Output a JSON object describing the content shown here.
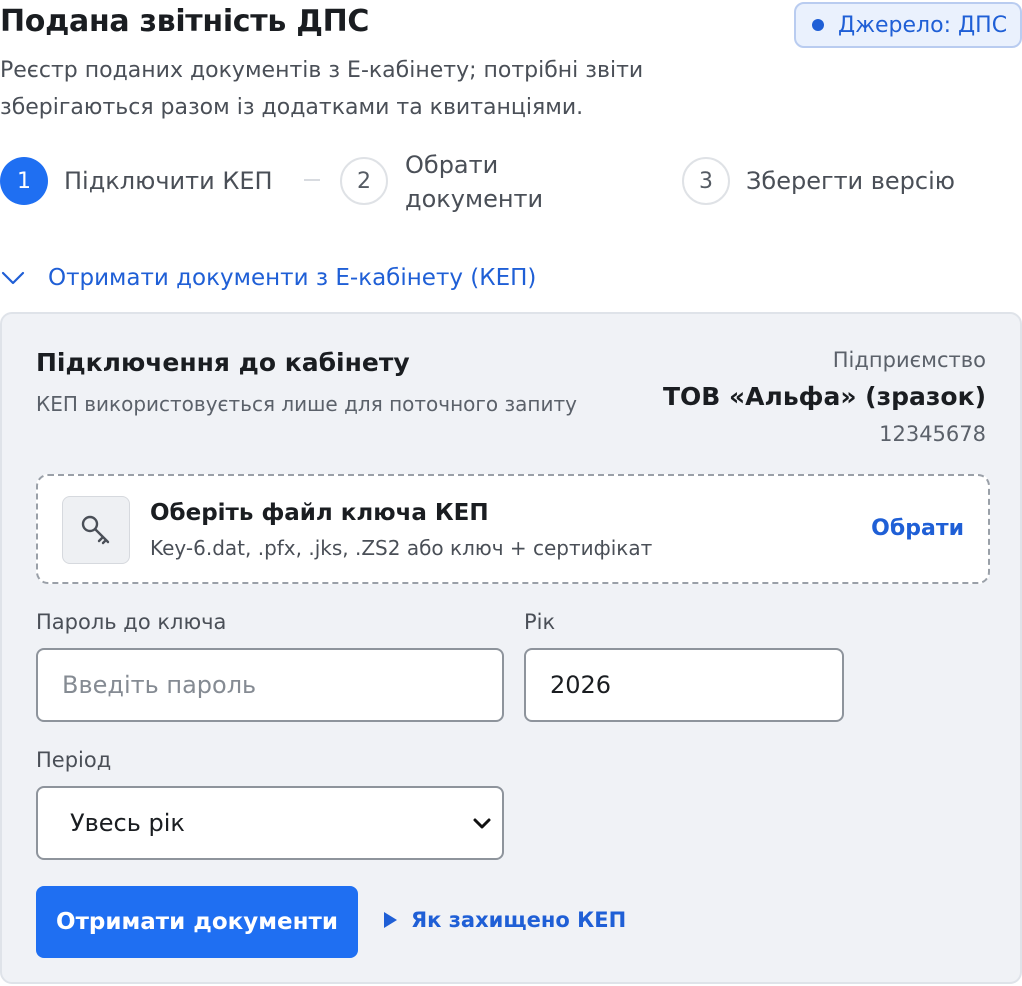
{
  "header": {
    "title": "Подана звітність ДПС",
    "description": "Реєстр поданих документів з Е-кабінету; потрібні звіти зберігаються разом із додатками та квитанціями.",
    "source_badge": "Джерело: ДПС"
  },
  "stepper": {
    "steps": [
      {
        "number": "1",
        "label": "Підключити КЕП",
        "state": "active"
      },
      {
        "number": "2",
        "label": "Обрати документи",
        "state": "idle"
      },
      {
        "number": "3",
        "label": "Зберегти версію",
        "state": "idle"
      }
    ]
  },
  "accordion": {
    "label": "Отримати документи з Е-кабінету (КЕП)",
    "expanded": true,
    "icon": "chevron-down-icon"
  },
  "connection": {
    "title": "Підключення до кабінету",
    "subtitle": "КЕП використовується лише для поточного запиту",
    "enterprise_label": "Підприємство",
    "enterprise_name": "ТОВ «Альфа» (зразок)",
    "enterprise_code": "12345678"
  },
  "key_file": {
    "icon": "key-icon",
    "title": "Оберіть файл ключа КЕП",
    "formats": "Key-6.dat, .pfx, .jks, .ZS2 або ключ + сертифікат",
    "action_label": "Обрати"
  },
  "form": {
    "password_label": "Пароль до ключа",
    "password_placeholder": "Введіть пароль",
    "year_label": "Рік",
    "year_value": "2026",
    "period_label": "Період",
    "period_value": "Увесь рік"
  },
  "actions": {
    "submit_label": "Отримати документи",
    "help_label": "Як захищено КЕП"
  },
  "colors": {
    "accent": "#1f6ff2",
    "link": "#1f5fd6",
    "panel_bg": "#f0f2f6"
  }
}
